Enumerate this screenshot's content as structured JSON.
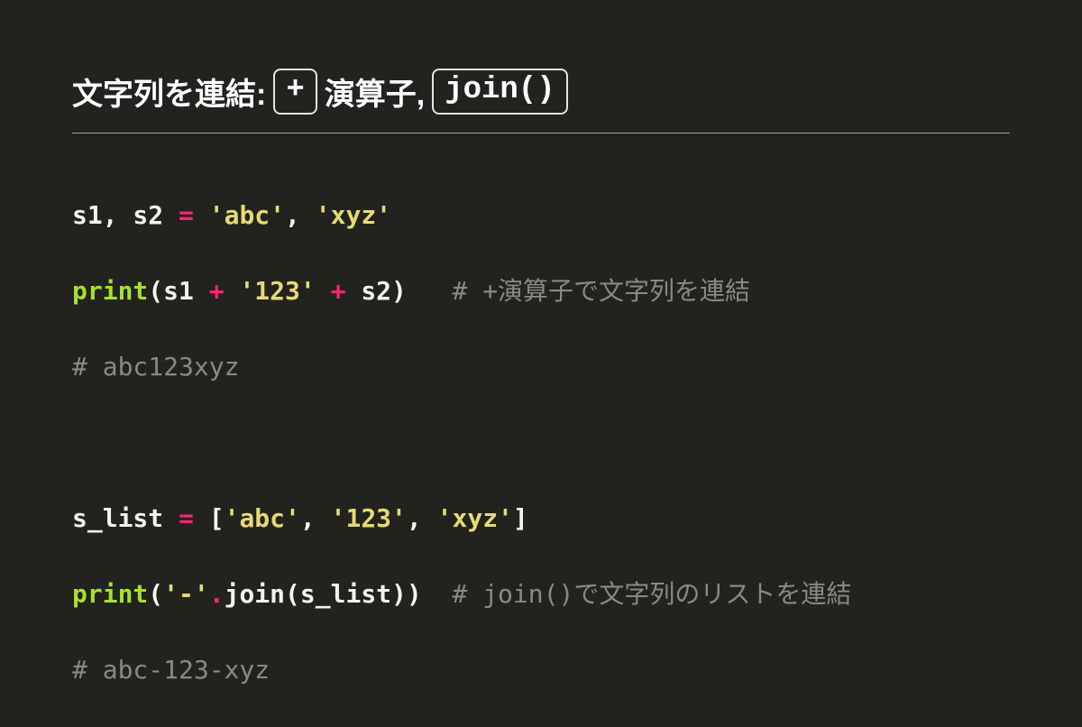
{
  "heading": {
    "t1": "文字列を連結: ",
    "box1": "+",
    "t2": "演算子,",
    "box2": "join()"
  },
  "code": {
    "l1": {
      "ids": "s1, s2 ",
      "eq": "=",
      "sp1": " ",
      "str1": "'abc'",
      "comma": ", ",
      "str2": "'xyz'"
    },
    "l2": {
      "fn": "print",
      "lp": "(",
      "a1": "s1 ",
      "op1": "+",
      "sp1": " ",
      "str1": "'123'",
      "sp2": " ",
      "op2": "+",
      "sp3": " ",
      "a2": "s2",
      "rp": ")",
      "pad": "   ",
      "comm": "# +演算子で文字列を連結"
    },
    "l3": {
      "comm": "# abc123xyz"
    },
    "l5": {
      "id": "s_list ",
      "eq": "=",
      "sp": " ",
      "lb": "[",
      "s1": "'abc'",
      "c1": ", ",
      "s2": "'123'",
      "c2": ", ",
      "s3": "'xyz'",
      "rb": "]"
    },
    "l6": {
      "fn": "print",
      "lp": "(",
      "str1": "'-'",
      "dot": ".",
      "method": "join",
      "lp2": "(",
      "arg": "s_list",
      "rp2": ")",
      "rp": ")",
      "pad": "  ",
      "comm": "# join()で文字列のリストを連結"
    },
    "l7": {
      "comm": "# abc-123-xyz"
    }
  }
}
